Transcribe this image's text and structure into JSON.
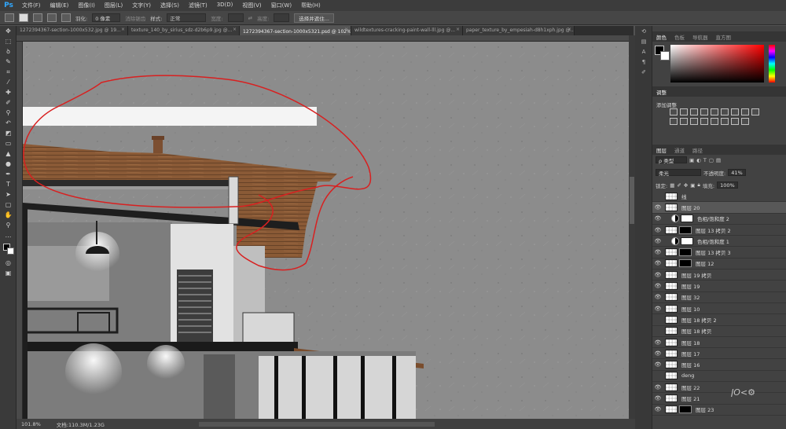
{
  "app": {
    "logo": "Ps"
  },
  "menu": [
    "文件(F)",
    "编辑(E)",
    "图像(I)",
    "图层(L)",
    "文字(Y)",
    "选择(S)",
    "滤镜(T)",
    "3D(D)",
    "视图(V)",
    "窗口(W)",
    "帮助(H)"
  ],
  "options": {
    "feather_label": "羽化:",
    "feather_value": "0 像素",
    "antialias_label": "消除锯齿",
    "style_label": "样式:",
    "style_value": "正常",
    "width_label": "宽度:",
    "height_label": "高度:",
    "select_mask_button": "选择并遮住..."
  },
  "tabs": [
    {
      "label": "1272394367-section-1000x532.jpg @ 19...",
      "active": false
    },
    {
      "label": "texture_140_by_sirius_sdz-d2b6p9.jpg @...",
      "active": false
    },
    {
      "label": "1272394367-section-1000x5321.psd @ 102% (图层 20, RGB/8#) *",
      "active": true
    },
    {
      "label": "wildtextures-cracking-paint-wall-lll.jpg @...",
      "active": false
    },
    {
      "label": "paper_texture_by_empesiah-d8h1xph.jpg @...",
      "active": false
    }
  ],
  "status": {
    "zoom": "101.8%",
    "doc": "文档:110.3M/1.23G"
  },
  "color_panel": {
    "tabs": [
      "颜色",
      "色板",
      "导航器",
      "直方图"
    ],
    "fg_color": "#000000",
    "bg_color": "#ffffff"
  },
  "adjustments_panel": {
    "tabs": [
      "调整"
    ],
    "title": "添加调整"
  },
  "layers_panel": {
    "tabs": [
      "图层",
      "通道",
      "路径"
    ],
    "filter_label": "ρ 类型",
    "blend_mode": "柔光",
    "opacity_label": "不透明度:",
    "opacity_value": "41%",
    "lock_label": "锁定:",
    "fill_label": "填充:",
    "fill_value": "100%",
    "layers": [
      {
        "name": "线",
        "visible": false,
        "kind": "plain"
      },
      {
        "name": "图层 20",
        "visible": true,
        "kind": "plain",
        "selected": true
      },
      {
        "name": "色相/饱和度 2",
        "visible": true,
        "kind": "adjust"
      },
      {
        "name": "图层 13 拷贝 2",
        "visible": true,
        "kind": "masked"
      },
      {
        "name": "色相/饱和度 1",
        "visible": true,
        "kind": "adjust"
      },
      {
        "name": "图层 13 拷贝 3",
        "visible": true,
        "kind": "masked"
      },
      {
        "name": "图层 12",
        "visible": true,
        "kind": "masked"
      },
      {
        "name": "图层 19 拷贝",
        "visible": true,
        "kind": "plain"
      },
      {
        "name": "图层 19",
        "visible": true,
        "kind": "plain"
      },
      {
        "name": "图层 32",
        "visible": true,
        "kind": "plain"
      },
      {
        "name": "图层 10",
        "visible": true,
        "kind": "plain"
      },
      {
        "name": "图层 18 拷贝 2",
        "visible": false,
        "kind": "plain"
      },
      {
        "name": "图层 18 拷贝",
        "visible": false,
        "kind": "plain"
      },
      {
        "name": "图层 18",
        "visible": true,
        "kind": "plain"
      },
      {
        "name": "图层 17",
        "visible": true,
        "kind": "plain"
      },
      {
        "name": "图层 16",
        "visible": true,
        "kind": "plain"
      },
      {
        "name": "deng",
        "visible": false,
        "kind": "plain"
      },
      {
        "name": "图层 22",
        "visible": true,
        "kind": "plain"
      },
      {
        "name": "图层 21",
        "visible": true,
        "kind": "plain"
      },
      {
        "name": "图层 23",
        "visible": true,
        "kind": "masked"
      }
    ]
  }
}
